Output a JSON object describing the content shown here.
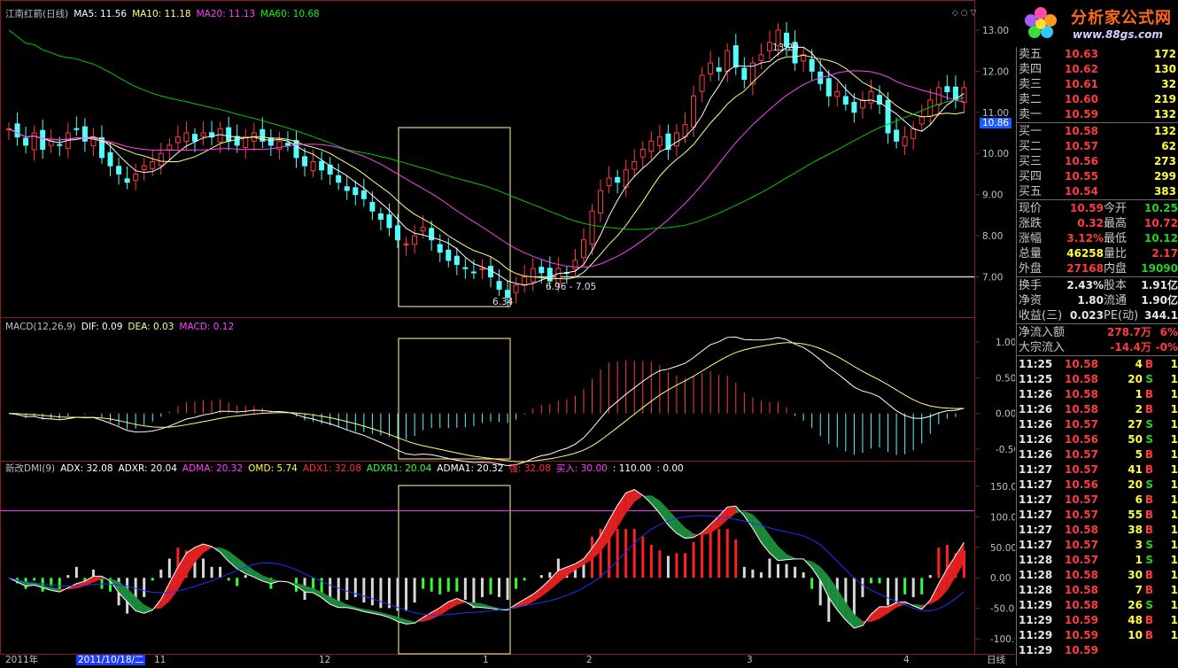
{
  "price_panel": {
    "title": "江南红箭(日线)",
    "ma_labels": [
      {
        "text": "MA5: 11.56",
        "color": "#ffffff"
      },
      {
        "text": "MA10: 11.18",
        "color": "#ffff80"
      },
      {
        "text": "MA20: 11.13",
        "color": "#ff40ff"
      },
      {
        "text": "MA60: 10.68",
        "color": "#00ff00"
      }
    ],
    "y_ticks": [
      "13.00",
      "12.00",
      "11.00",
      "10.00",
      "9.00",
      "8.00",
      "7.00"
    ],
    "current_price_tag": "10.86",
    "annotations": {
      "high": "13.20",
      "low": "6.34",
      "range": "6.96 - 7.05"
    },
    "icons": [
      "diamond-icon",
      "dot-icon",
      "down-triangle-icon"
    ]
  },
  "macd_panel": {
    "labels": [
      {
        "text": "MACD(12,26,9)",
        "color": "#c0c0c0"
      },
      {
        "text": "DIF: 0.09",
        "color": "#ffffff"
      },
      {
        "text": "DEA: 0.03",
        "color": "#ffff80"
      },
      {
        "text": "MACD: 0.12",
        "color": "#ff40ff"
      }
    ],
    "y_ticks": [
      "1.00",
      "0.50",
      "0.00",
      "-0.50"
    ]
  },
  "dmi_panel": {
    "labels": [
      {
        "text": "新改DMI(9)",
        "color": "#c0c0c0"
      },
      {
        "text": "ADX: 32.08",
        "color": "#ffffff"
      },
      {
        "text": "ADXR: 20.04",
        "color": "#ffffff"
      },
      {
        "text": "ADMA: 20.32",
        "color": "#ff40ff"
      },
      {
        "text": "OMD: 5.74",
        "color": "#ffff40"
      },
      {
        "text": "ADX1: 32.08",
        "color": "#ff3030"
      },
      {
        "text": "ADXR1: 20.04",
        "color": "#40ff40"
      },
      {
        "text": "ADMA1: 20.32",
        "color": "#ffffff"
      },
      {
        "text": "强: 32.08",
        "color": "#ff3030"
      },
      {
        "text": "买入: 30.00",
        "color": "#ff40ff"
      },
      {
        "text": ": 110.00",
        "color": "#ffffff"
      },
      {
        "text": ": 0.00",
        "color": "#ffffff"
      }
    ],
    "y_ticks": [
      "150.00",
      "100.00",
      "50.00",
      "0.00",
      "-50.00",
      "-100.00"
    ]
  },
  "time_axis": {
    "labels": [
      "2011年",
      "2011/10/18/二",
      "11",
      "12",
      "1",
      "2",
      "3",
      "4"
    ],
    "period": "日线"
  },
  "logo": {
    "brand": "分析家公式网",
    "url": "www.88gs.com"
  },
  "orderbook": {
    "asks": [
      {
        "label": "卖五",
        "price": "10.63",
        "vol": "172"
      },
      {
        "label": "卖四",
        "price": "10.62",
        "vol": "130"
      },
      {
        "label": "卖三",
        "price": "10.61",
        "vol": "32"
      },
      {
        "label": "卖二",
        "price": "10.60",
        "vol": "219"
      },
      {
        "label": "卖一",
        "price": "10.59",
        "vol": "132"
      }
    ],
    "bids": [
      {
        "label": "买一",
        "price": "10.58",
        "vol": "132"
      },
      {
        "label": "买二",
        "price": "10.57",
        "vol": "62"
      },
      {
        "label": "买三",
        "price": "10.56",
        "vol": "273"
      },
      {
        "label": "买四",
        "price": "10.55",
        "vol": "299"
      },
      {
        "label": "买五",
        "price": "10.54",
        "vol": "383"
      }
    ]
  },
  "quote": [
    {
      "l1": "现价",
      "v1": "10.59",
      "c1": "red",
      "l2": "今开",
      "v2": "10.25",
      "c2": "green"
    },
    {
      "l1": "涨跌",
      "v1": "0.32",
      "c1": "red",
      "l2": "最高",
      "v2": "10.72",
      "c2": "red"
    },
    {
      "l1": "涨幅",
      "v1": "3.12%",
      "c1": "red",
      "l2": "最低",
      "v2": "10.12",
      "c2": "green"
    },
    {
      "l1": "总量",
      "v1": "46258",
      "c1": "yellow",
      "l2": "量比",
      "v2": "2.17",
      "c2": "red"
    },
    {
      "l1": "外盘",
      "v1": "27168",
      "c1": "red",
      "l2": "内盘",
      "v2": "19090",
      "c2": "green"
    }
  ],
  "stats": [
    {
      "l1": "换手",
      "v1": "2.43%",
      "c1": "white",
      "l2": "股本",
      "v2": "1.91亿",
      "c2": "white"
    },
    {
      "l1": "净资",
      "v1": "1.80",
      "c1": "white",
      "l2": "流通",
      "v2": "1.90亿",
      "c2": "white"
    },
    {
      "l1": "收益(三)",
      "v1": "0.023",
      "c1": "white",
      "l2": "PE(动)",
      "v2": "344.1",
      "c2": "white"
    }
  ],
  "flows": [
    {
      "label": "净流入额",
      "value": "278.7万",
      "pct": "6%"
    },
    {
      "label": "大宗流入",
      "value": "-14.4万",
      "pct": "-0%"
    }
  ],
  "trades": [
    {
      "t": "11:25",
      "p": "10.58",
      "q": "4",
      "d": "B"
    },
    {
      "t": "11:25",
      "p": "10.58",
      "q": "20",
      "d": "S"
    },
    {
      "t": "11:26",
      "p": "10.58",
      "q": "1",
      "d": "B"
    },
    {
      "t": "11:26",
      "p": "10.58",
      "q": "2",
      "d": "B"
    },
    {
      "t": "11:26",
      "p": "10.57",
      "q": "27",
      "d": "S"
    },
    {
      "t": "11:26",
      "p": "10.56",
      "q": "50",
      "d": "S"
    },
    {
      "t": "11:26",
      "p": "10.57",
      "q": "5",
      "d": "B"
    },
    {
      "t": "11:27",
      "p": "10.57",
      "q": "41",
      "d": "B"
    },
    {
      "t": "11:27",
      "p": "10.56",
      "q": "20",
      "d": "S"
    },
    {
      "t": "11:27",
      "p": "10.57",
      "q": "6",
      "d": "B"
    },
    {
      "t": "11:27",
      "p": "10.57",
      "q": "55",
      "d": "B"
    },
    {
      "t": "11:27",
      "p": "10.58",
      "q": "38",
      "d": "B"
    },
    {
      "t": "11:27",
      "p": "10.57",
      "q": "3",
      "d": "S"
    },
    {
      "t": "11:28",
      "p": "10.57",
      "q": "1",
      "d": "S"
    },
    {
      "t": "11:28",
      "p": "10.58",
      "q": "30",
      "d": "B"
    },
    {
      "t": "11:28",
      "p": "10.58",
      "q": "7",
      "d": "B"
    },
    {
      "t": "11:29",
      "p": "10.58",
      "q": "26",
      "d": "S"
    },
    {
      "t": "11:29",
      "p": "10.59",
      "q": "48",
      "d": "B"
    },
    {
      "t": "11:29",
      "p": "10.59",
      "q": "10",
      "d": "B"
    },
    {
      "t": "11:29",
      "p": "10.59",
      "q": "",
      "d": ""
    }
  ],
  "colors": {
    "up": "#ff3c3c",
    "down": "#54fcfc",
    "ma5": "#ffffff",
    "ma10": "#ffff80",
    "ma20": "#ff40ff",
    "ma60": "#00c800",
    "box": "#e0d080"
  },
  "chart_data": {
    "type": "candlestick",
    "note_series": "approximate daily closes read from price axis",
    "closes": [
      10.6,
      10.4,
      10.2,
      10.5,
      10.1,
      10.3,
      10.2,
      10.5,
      10.6,
      10.3,
      10.4,
      9.9,
      9.7,
      9.5,
      9.3,
      9.5,
      9.7,
      9.8,
      10.0,
      10.2,
      10.4,
      10.5,
      10.3,
      10.5,
      10.4,
      10.6,
      10.3,
      10.2,
      10.4,
      10.5,
      10.3,
      10.2,
      10.3,
      10.2,
      9.9,
      9.7,
      9.8,
      9.6,
      9.5,
      9.3,
      9.1,
      9.0,
      8.9,
      8.6,
      8.4,
      8.2,
      7.9,
      7.8,
      8.0,
      8.2,
      7.9,
      7.6,
      7.4,
      7.3,
      7.2,
      7.1,
      7.2,
      7.0,
      6.7,
      6.5,
      6.8,
      7.0,
      7.2,
      7.1,
      6.9,
      7.2,
      7.1,
      7.4,
      7.9,
      8.6,
      9.1,
      9.4,
      9.3,
      9.6,
      9.8,
      10.1,
      10.3,
      10.4,
      10.1,
      10.5,
      10.7,
      11.4,
      11.9,
      12.2,
      12.0,
      12.5,
      12.1,
      11.8,
      12.2,
      12.4,
      12.7,
      13.0,
      12.6,
      12.2,
      12.4,
      12.0,
      11.7,
      11.4,
      11.5,
      11.2,
      11.0,
      11.3,
      11.5,
      11.2,
      10.5,
      10.3,
      10.4,
      10.6,
      10.9,
      11.3,
      11.6,
      11.5,
      11.3,
      11.6
    ],
    "price_range": [
      6.3,
      13.3
    ],
    "macd_range": [
      -0.6,
      1.1
    ],
    "dmi_range": [
      -120,
      170
    ]
  }
}
